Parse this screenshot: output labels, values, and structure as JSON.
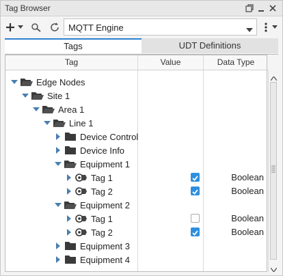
{
  "window": {
    "title": "Tag Browser"
  },
  "toolbar": {
    "source_value": "MQTT Engine"
  },
  "tabs": [
    {
      "label": "Tags"
    },
    {
      "label": "UDT Definitions"
    }
  ],
  "columns": [
    {
      "label": "Tag"
    },
    {
      "label": "Value"
    },
    {
      "label": "Data Type"
    }
  ],
  "tree": {
    "edge_nodes": "Edge Nodes",
    "site1": "Site 1",
    "area1": "Area 1",
    "line1": "Line 1",
    "device_control": "Device Control",
    "device_info": "Device Info",
    "equipment1": "Equipment 1",
    "eq1_tag1": {
      "label": "Tag 1",
      "checked": true,
      "type": "Boolean"
    },
    "eq1_tag2": {
      "label": "Tag 2",
      "checked": true,
      "type": "Boolean"
    },
    "equipment2": "Equipment 2",
    "eq2_tag1": {
      "label": "Tag 1",
      "checked": false,
      "type": "Boolean"
    },
    "eq2_tag2": {
      "label": "Tag 2",
      "checked": true,
      "type": "Boolean"
    },
    "equipment3": "Equipment 3",
    "equipment4": "Equipment 4"
  }
}
